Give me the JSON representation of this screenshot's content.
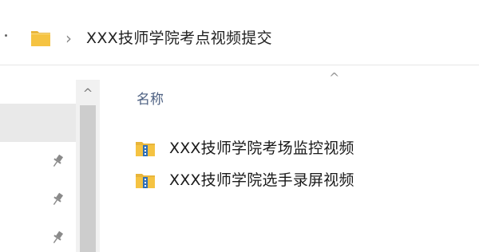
{
  "address_bar": {
    "path": "XXX技师学院考点视频提交",
    "folder_icon": "folder-icon",
    "separator_icon": "chevron-right-icon"
  },
  "nav_pane": {
    "scroll_up_icon": "chevron-up-icon",
    "pin_icons": [
      "pin-icon",
      "pin-icon",
      "pin-icon"
    ]
  },
  "file_list": {
    "sort_icon": "sort-ascending-icon",
    "column_name": "名称",
    "items": [
      {
        "name": "XXX技师学院考场监控视频",
        "icon": "zip-folder-icon"
      },
      {
        "name": "XXX技师学院选手录屏视频",
        "icon": "zip-folder-icon"
      }
    ]
  },
  "colors": {
    "header_text": "#4d6082",
    "folder_yellow": "#f5c342",
    "scroll_thumb": "#cdcdcd"
  }
}
